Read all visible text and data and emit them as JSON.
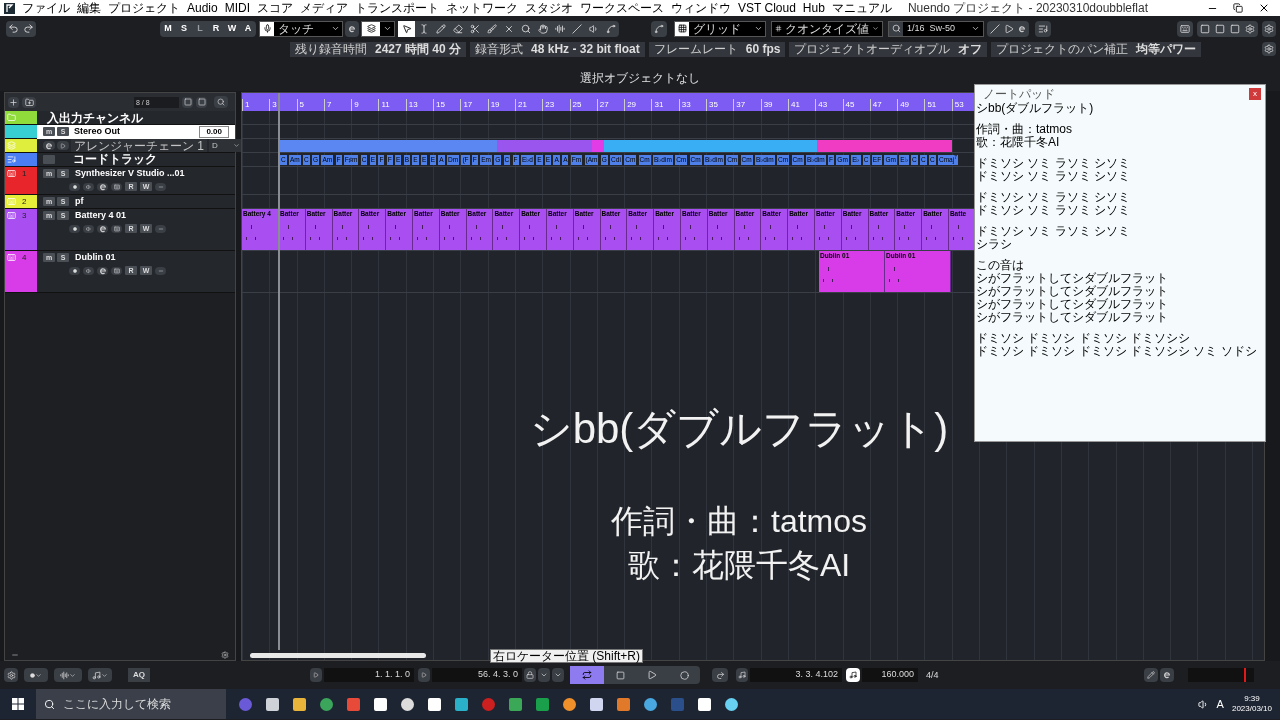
{
  "menu_bar": {
    "menus": [
      "ファイル",
      "編集",
      "プロジェクト",
      "Audio",
      "MIDI",
      "スコア",
      "メディア",
      "トランスポート",
      "ネットワーク",
      "スタジオ",
      "ワークスペース",
      "ウィンドウ",
      "VST Cloud",
      "Hub",
      "マニュアル"
    ],
    "title": "Nuendo プロジェクト - 20230310doubbleflat"
  },
  "toolbar": {
    "automation_buttons": [
      {
        "label": "M",
        "disabled": false
      },
      {
        "label": "S",
        "disabled": false
      },
      {
        "label": "L",
        "disabled": true
      },
      {
        "label": "R",
        "disabled": false
      },
      {
        "label": "W",
        "disabled": false
      },
      {
        "label": "A",
        "disabled": false
      }
    ],
    "automation_mode": "タッチ",
    "tools": [
      {
        "selected": true
      },
      {
        "selected": false
      },
      {
        "selected": false
      },
      {
        "selected": false
      },
      {
        "selected": false
      },
      {
        "selected": false
      },
      {
        "selected": false
      },
      {
        "selected": false
      },
      {
        "selected": false
      },
      {
        "selected": false
      },
      {
        "selected": false
      },
      {
        "selected": false
      },
      {
        "selected": false
      }
    ],
    "snap_type": "グリッド",
    "quantize_mode": "クオンタイズ値",
    "quantize_value": "1/16  Sw-50"
  },
  "info_bar": [
    {
      "label": "残り録音時間",
      "value": "2427 時間 40 分"
    },
    {
      "label": "録音形式",
      "value": "48 kHz - 32 bit float"
    },
    {
      "label": "フレームレート",
      "value": "60 fps"
    },
    {
      "label": "プロジェクトオーディオプル",
      "value": "オフ"
    },
    {
      "label": "プロジェクトのパン補正",
      "value": "均等パワー"
    }
  ],
  "status": "選択オブジェクトなし",
  "track_list": {
    "count": "8 / 8",
    "tracks": [
      {
        "kind": "folder",
        "name": "入出力チャンネル",
        "color": "#8fdc3a"
      },
      {
        "kind": "output",
        "name": "Stereo Out",
        "mute": "m",
        "solo": "S",
        "volume": "0.00",
        "color": "#38cfd2"
      },
      {
        "kind": "arranger",
        "chain": "アレンジャーチェーン 1",
        "section": "D",
        "color": "#dfee3c"
      },
      {
        "kind": "chord",
        "name": "コードトラック",
        "color": "#4b7ef2"
      },
      {
        "kind": "instrument",
        "number": "1",
        "name": "Synthesizer V Studio ...01",
        "mute": "m",
        "solo": "S",
        "controls": true,
        "read": "R",
        "write": "W",
        "color": "#e8252b"
      },
      {
        "kind": "instrument",
        "number": "2",
        "name": "pf",
        "mute": "m",
        "solo": "S",
        "controls": false,
        "color": "#e6ee3a"
      },
      {
        "kind": "instrument",
        "number": "3",
        "name": "Battery 4 01",
        "mute": "m",
        "solo": "S",
        "controls": true,
        "read": "R",
        "write": "W",
        "color": "#a94ff2",
        "events": [
          "Battery 4",
          "Batter",
          "Batter",
          "Batter",
          "Batter",
          "Batter",
          "Batter",
          "Batter",
          "Batter",
          "Batter",
          "Batter",
          "Batter",
          "Batter",
          "Batter",
          "Batter",
          "Batter",
          "Batter",
          "Batter",
          "Batter",
          "Batter",
          "Batter",
          "Batter",
          "Batter",
          "Batter",
          "Batter",
          "Batter",
          "Batte"
        ]
      },
      {
        "kind": "instrument",
        "number": "4",
        "name": "Dublin 01",
        "mute": "m",
        "solo": "S",
        "controls": true,
        "read": "R",
        "write": "W",
        "color": "#d83ce8",
        "events": [
          "Dublin 01",
          "Dublin 01"
        ]
      }
    ]
  },
  "arrange": {
    "ruler": [
      "1",
      "3",
      "5",
      "7",
      "9",
      "11",
      "13",
      "15",
      "17",
      "19",
      "21",
      "23",
      "25",
      "27",
      "29",
      "31",
      "33",
      "35",
      "37",
      "39",
      "41",
      "43",
      "45",
      "47",
      "49",
      "51",
      "53"
    ],
    "arranger_segments": [
      {
        "color": "#5b87f2"
      },
      {
        "color": "#9b55ef"
      },
      {
        "color": "#e23ce6"
      },
      {
        "color": "#3aaef4"
      },
      {
        "color": "#f03cc3"
      }
    ],
    "chords": [
      "C",
      "Am",
      "C",
      "G",
      "Am",
      "F",
      "F♯m",
      "C",
      "E",
      "F",
      "F",
      "E",
      "B",
      "E",
      "E",
      "E",
      "A",
      "Dm",
      "(F",
      "F",
      "Em",
      "G",
      "C",
      "F",
      "E♭d",
      "E",
      "E",
      "A",
      "A",
      "Fm",
      "(Am",
      "G",
      "Cdi",
      "Cm",
      "Cm",
      "B♭dim",
      "Cm",
      "Cm",
      "B♭dim",
      "Cm",
      "Cm",
      "B♭dim",
      "Cm",
      "Cm",
      "B♭dim",
      "F",
      "Gm",
      "E♭",
      "C",
      "EF",
      "Gm",
      "E♭",
      "C",
      "C",
      "C",
      "Cmaj$^{7}$"
    ]
  },
  "captions": [
    "シbb(ダブルフラット)",
    "作詞・曲：tatmos",
    "歌：花隈千冬AI"
  ],
  "notepad": {
    "title": "ノートパッド",
    "close": "x",
    "paragraphs": [
      [
        "シbb(ダブルフラット)"
      ],
      [
        "作詞・曲：tatmos",
        "歌：花隈千冬AI"
      ],
      [
        "ドミソシ ソミ ラソミ シソミ",
        "ドミソシ ソミ ラソミ シソミ"
      ],
      [
        "ドミソシ ソミ ラソミ シソミ",
        "ドミソシ ソミ ラソミ シソミ"
      ],
      [
        "ドミソシ ソミ ラソミ シソミ",
        "シラシ"
      ],
      [
        "この音は",
        "シがフラットしてシダブルフラット",
        "シがフラットしてシダブルフラット",
        "シがフラットしてシダブルフラット",
        "シがフラットしてシダブルフラット"
      ],
      [
        "ドミソシ ドミソシ ドミソシ ドミソシシ",
        "ドミソシ ドミソシ ドミソシ ドミソシシ ソミ ソドシ"
      ]
    ]
  },
  "transport": {
    "quantize": "AQ",
    "left_locator": "1. 1. 1. 0",
    "right_locator": "56. 4. 3. 0",
    "tooltip": "右ロケーター位置 (Shift+R)",
    "cycle_on": true,
    "position": "3. 3. 4.102",
    "tempo": "160.000",
    "signature": "4/4"
  },
  "taskbar": {
    "search_placeholder": "ここに入力して検索",
    "ime": "A",
    "time": "9:39",
    "date": "2023/03/10"
  }
}
